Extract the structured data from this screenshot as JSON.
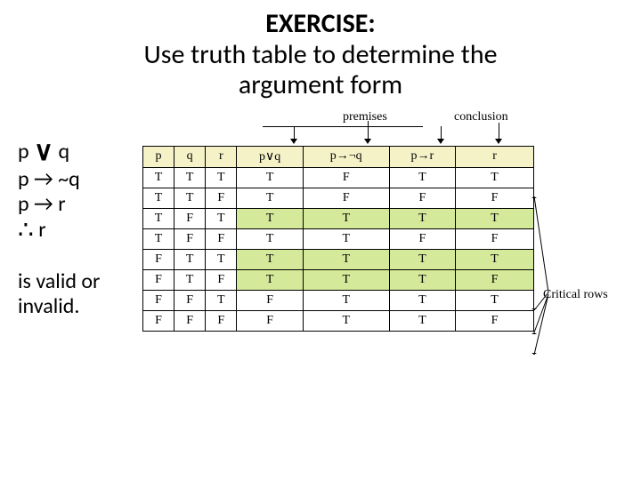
{
  "title": {
    "line1": "EXERCISE:",
    "line2": "Use truth table to determine the",
    "line3": "argument form"
  },
  "argument": {
    "l1_pre": "p ",
    "l1_op": "∨",
    "l1_post": " q",
    "l2": "p → ~q",
    "l3": "p → r",
    "l4_op": "∴",
    "l4_post": " r"
  },
  "valid": {
    "l1": "is valid or",
    "l2": "invalid."
  },
  "labels": {
    "premises": "premises",
    "conclusion": "conclusion",
    "critical": "Critical rows"
  },
  "chart_data": {
    "type": "table",
    "headers": [
      "p",
      "q",
      "r",
      "p∨q",
      "p→¬q",
      "p→r",
      "r"
    ],
    "rows": [
      {
        "cells": [
          "T",
          "T",
          "T",
          "T",
          "F",
          "T",
          "T"
        ],
        "critical": false
      },
      {
        "cells": [
          "T",
          "T",
          "F",
          "T",
          "F",
          "F",
          "F"
        ],
        "critical": false
      },
      {
        "cells": [
          "T",
          "F",
          "T",
          "T",
          "T",
          "T",
          "T"
        ],
        "critical": true
      },
      {
        "cells": [
          "T",
          "F",
          "F",
          "T",
          "T",
          "F",
          "F"
        ],
        "critical": false
      },
      {
        "cells": [
          "F",
          "T",
          "T",
          "T",
          "T",
          "T",
          "T"
        ],
        "critical": true
      },
      {
        "cells": [
          "F",
          "T",
          "F",
          "T",
          "T",
          "T",
          "F"
        ],
        "critical": true
      },
      {
        "cells": [
          "F",
          "F",
          "T",
          "F",
          "T",
          "T",
          "T"
        ],
        "critical": false
      },
      {
        "cells": [
          "F",
          "F",
          "F",
          "F",
          "T",
          "T",
          "F"
        ],
        "critical": false
      }
    ]
  }
}
